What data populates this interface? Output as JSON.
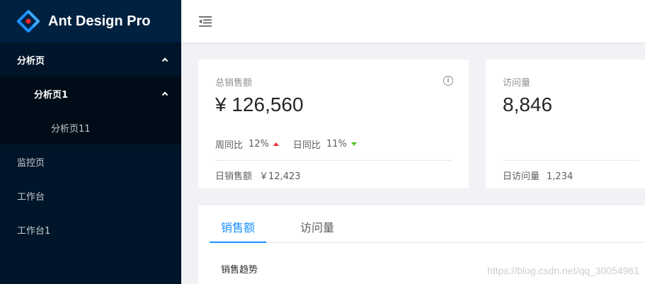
{
  "brand": {
    "name": "Ant Design Pro",
    "logo_icon": "ant-design-logo",
    "colors": {
      "blue": "#1890ff",
      "red": "#f5222d",
      "sider": "#001529"
    }
  },
  "sidebar": {
    "items": [
      {
        "label": "分析页",
        "level": 1,
        "open": true
      },
      {
        "label": "分析页1",
        "level": 2,
        "open": true
      },
      {
        "label": "分析页11",
        "level": 3
      },
      {
        "label": "监控页",
        "level": 1
      },
      {
        "label": "工作台",
        "level": 1
      },
      {
        "label": "工作台1",
        "level": 1
      }
    ]
  },
  "header": {
    "fold_icon": "menu-fold-icon"
  },
  "cards": {
    "total_sales": {
      "label": "总销售额",
      "value": "¥ 126,560",
      "info_icon": "info-circle-icon",
      "weekly_label": "周同比",
      "weekly_value": "12%",
      "weekly_trend": "up",
      "daily_label": "日同比",
      "daily_value": "11%",
      "daily_trend": "down",
      "footer_label": "日销售额",
      "footer_value": "￥12,423"
    },
    "visits": {
      "label": "访问量",
      "value": "8,846",
      "footer_label": "日访问量",
      "footer_value": "1,234"
    }
  },
  "sales_tabs": {
    "tabs": [
      {
        "label": "销售额",
        "active": true
      },
      {
        "label": "访问量",
        "active": false
      }
    ],
    "section_title": "销售趋势"
  },
  "watermark": "https://blog.csdn.net/qq_30054961"
}
